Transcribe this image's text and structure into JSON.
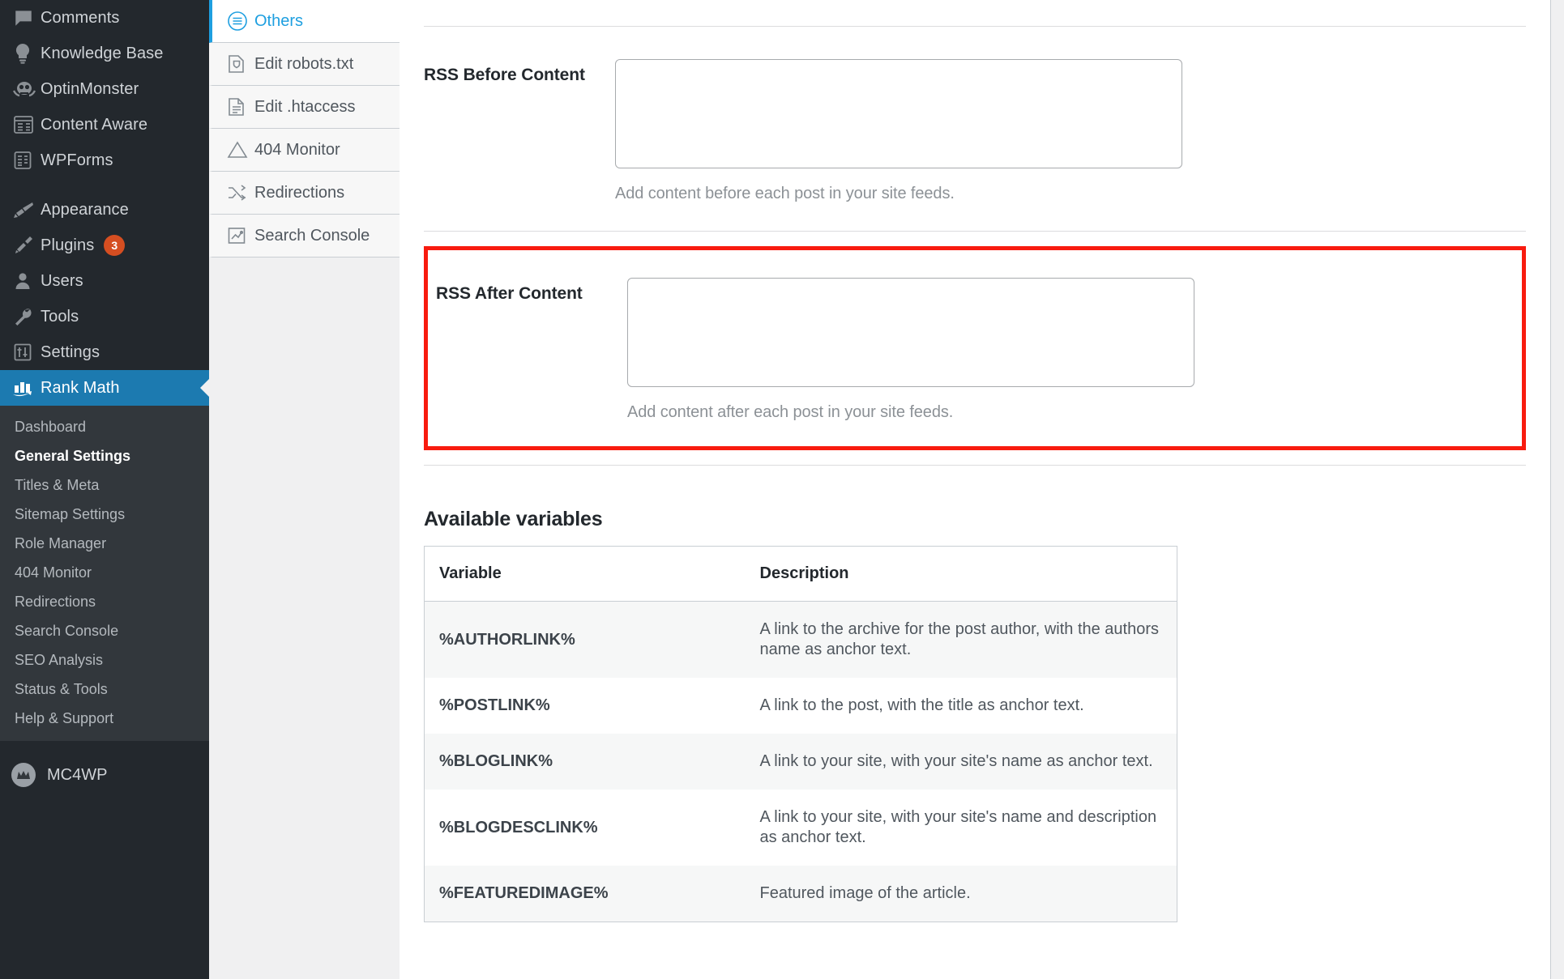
{
  "wp_sidebar": {
    "items": [
      {
        "label": "Comments",
        "icon": "comments-icon",
        "badge": null
      },
      {
        "label": "Knowledge Base",
        "icon": "lightbulb-icon",
        "badge": null
      },
      {
        "label": "OptinMonster",
        "icon": "optinmonster-icon",
        "badge": null
      },
      {
        "label": "Content Aware",
        "icon": "content-aware-icon",
        "badge": null
      },
      {
        "label": "WPForms",
        "icon": "wpforms-icon",
        "badge": null
      },
      {
        "label": "Appearance",
        "icon": "appearance-brush-icon",
        "badge": null
      },
      {
        "label": "Plugins",
        "icon": "plugins-plug-icon",
        "badge": "3"
      },
      {
        "label": "Users",
        "icon": "users-person-icon",
        "badge": null
      },
      {
        "label": "Tools",
        "icon": "tools-wrench-icon",
        "badge": null
      },
      {
        "label": "Settings",
        "icon": "settings-sliders-icon",
        "badge": null
      },
      {
        "label": "Rank Math",
        "icon": "rank-math-icon",
        "badge": null
      }
    ],
    "submenu": [
      {
        "label": "Dashboard",
        "current": false
      },
      {
        "label": "General Settings",
        "current": true
      },
      {
        "label": "Titles & Meta",
        "current": false
      },
      {
        "label": "Sitemap Settings",
        "current": false
      },
      {
        "label": "Role Manager",
        "current": false
      },
      {
        "label": "404 Monitor",
        "current": false
      },
      {
        "label": "Redirections",
        "current": false
      },
      {
        "label": "Search Console",
        "current": false
      },
      {
        "label": "SEO Analysis",
        "current": false
      },
      {
        "label": "Status & Tools",
        "current": false
      },
      {
        "label": "Help & Support",
        "current": false
      }
    ],
    "bottom_item": {
      "label": "MC4WP",
      "icon": "mc4wp-logo-icon"
    },
    "active_item": "Rank Math",
    "colors": {
      "background": "#23282d",
      "submenu_background": "#32373c",
      "active": "#1c7ab0",
      "badge": "#d54e21"
    }
  },
  "tabs": {
    "items": [
      {
        "label": "Others",
        "icon": "list-circle-icon",
        "active": true
      },
      {
        "label": "Edit robots.txt",
        "icon": "robots-shield-file-icon",
        "active": false
      },
      {
        "label": "Edit .htaccess",
        "icon": "document-lines-icon",
        "active": false
      },
      {
        "label": "404 Monitor",
        "icon": "warning-triangle-icon",
        "active": false
      },
      {
        "label": "Redirections",
        "icon": "shuffle-arrows-icon",
        "active": false
      },
      {
        "label": "Search Console",
        "icon": "analytics-chart-icon",
        "active": false
      }
    ],
    "accent_color": "#1e9fe0"
  },
  "main": {
    "fields": [
      {
        "label": "RSS Before Content",
        "value": "",
        "placeholder": "",
        "description": "Add content before each post in your site feeds.",
        "highlighted": false
      },
      {
        "label": "RSS After Content",
        "value": "",
        "placeholder": "",
        "description": "Add content after each post in your site feeds.",
        "highlighted": true
      }
    ],
    "highlight_color": "#f81b0f",
    "variables_section": {
      "title": "Available variables",
      "columns": [
        "Variable",
        "Description"
      ],
      "rows": [
        {
          "variable": "%AUTHORLINK%",
          "description": "A link to the archive for the post author, with the authors name as anchor text."
        },
        {
          "variable": "%POSTLINK%",
          "description": "A link to the post, with the title as anchor text."
        },
        {
          "variable": "%BLOGLINK%",
          "description": "A link to your site, with your site's name as anchor text."
        },
        {
          "variable": "%BLOGDESCLINK%",
          "description": "A link to your site, with your site's name and description as anchor text."
        },
        {
          "variable": "%FEATUREDIMAGE%",
          "description": "Featured image of the article."
        }
      ]
    }
  }
}
